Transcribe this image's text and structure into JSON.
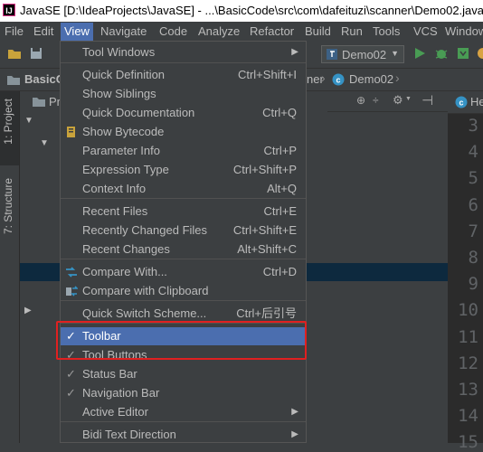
{
  "window": {
    "title": "JavaSE [D:\\IdeaProjects\\JavaSE] - ...\\BasicCode\\src\\com\\dafeituzi\\scanner\\Demo02.java"
  },
  "menubar": {
    "items": [
      "File",
      "Edit",
      "View",
      "Navigate",
      "Code",
      "Analyze",
      "Refactor",
      "Build",
      "Run",
      "Tools",
      "VCS",
      "Window"
    ]
  },
  "toolbar": {
    "run_config": "Demo02"
  },
  "navbar": {
    "project": "BasicC",
    "crumb_partial": "ner",
    "file": "Demo02"
  },
  "sidebar": {
    "tab_project": "1: Project",
    "tab_structure": "7: Structure"
  },
  "project_panel": {
    "header_partial": "Pr",
    "editor_tab_partial": "He"
  },
  "editor": {
    "line_numbers": [
      "3",
      "4",
      "5",
      "6",
      "7",
      "8",
      "9",
      "10",
      "11",
      "12",
      "13",
      "14",
      "15"
    ]
  },
  "view_menu": {
    "items": [
      {
        "label": "Tool Windows",
        "shortcut": "",
        "submenu": true
      },
      {
        "label": "Quick Definition",
        "shortcut": "Ctrl+Shift+I"
      },
      {
        "label": "Show Siblings",
        "shortcut": ""
      },
      {
        "label": "Quick Documentation",
        "shortcut": "Ctrl+Q"
      },
      {
        "label": "Show Bytecode",
        "shortcut": ""
      },
      {
        "label": "Parameter Info",
        "shortcut": "Ctrl+P"
      },
      {
        "label": "Expression Type",
        "shortcut": "Ctrl+Shift+P"
      },
      {
        "label": "Context Info",
        "shortcut": "Alt+Q"
      },
      {
        "label": "Recent Files",
        "shortcut": "Ctrl+E"
      },
      {
        "label": "Recently Changed Files",
        "shortcut": "Ctrl+Shift+E"
      },
      {
        "label": "Recent Changes",
        "shortcut": "Alt+Shift+C"
      },
      {
        "label": "Compare With...",
        "shortcut": "Ctrl+D"
      },
      {
        "label": "Compare with Clipboard",
        "shortcut": ""
      },
      {
        "label": "Quick Switch Scheme...",
        "shortcut": "Ctrl+后引号"
      },
      {
        "label": "Toolbar",
        "shortcut": "",
        "checked": true
      },
      {
        "label": "Tool Buttons",
        "shortcut": "",
        "checked": true
      },
      {
        "label": "Status Bar",
        "shortcut": "",
        "checked": true
      },
      {
        "label": "Navigation Bar",
        "shortcut": "",
        "checked": true
      },
      {
        "label": "Active Editor",
        "shortcut": "",
        "submenu": true
      },
      {
        "label": "Bidi Text Direction",
        "shortcut": "",
        "submenu": true
      }
    ]
  },
  "colors": {
    "menu_selection": "#4b6eaf",
    "annotation_box": "#e02020",
    "run_green": "#499c54"
  }
}
